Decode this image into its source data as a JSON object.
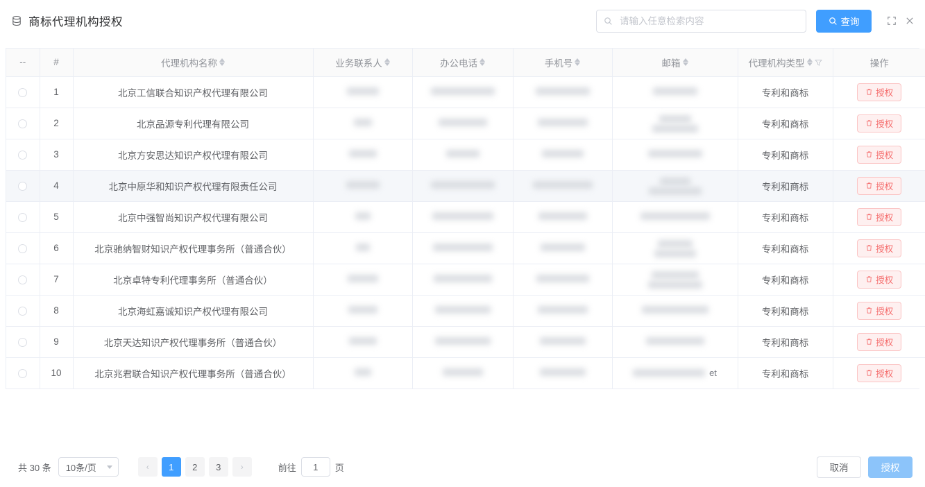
{
  "header": {
    "title": "商标代理机构授权",
    "icon": "database-icon",
    "search": {
      "placeholder": "请输入任意检索内容",
      "value": "",
      "icon": "search-icon"
    },
    "query_button": "查询",
    "fullscreen_icon": "fullscreen-icon",
    "close_icon": "close-icon"
  },
  "table": {
    "columns": [
      {
        "label": "--",
        "sortable": false,
        "filterable": false
      },
      {
        "label": "#",
        "sortable": false,
        "filterable": false
      },
      {
        "label": "代理机构名称",
        "sortable": true,
        "filterable": false
      },
      {
        "label": "业务联系人",
        "sortable": true,
        "filterable": false
      },
      {
        "label": "办公电话",
        "sortable": true,
        "filterable": false
      },
      {
        "label": "手机号",
        "sortable": true,
        "filterable": false
      },
      {
        "label": "邮箱",
        "sortable": true,
        "filterable": false
      },
      {
        "label": "代理机构类型",
        "sortable": true,
        "filterable": true
      },
      {
        "label": "操作",
        "sortable": false,
        "filterable": false
      }
    ],
    "action_label": "授权",
    "action_icon": "trash-icon",
    "rows": [
      {
        "index": "1",
        "name": "北京工信联合知识产权代理有限公司",
        "contact_redacted": true,
        "office_phone_redacted": true,
        "mobile_redacted": true,
        "email_redacted": true,
        "email_tail": "",
        "type": "专利和商标",
        "hovered": false
      },
      {
        "index": "2",
        "name": "北京品源专利代理有限公司",
        "contact_redacted": true,
        "office_phone_redacted": true,
        "mobile_redacted": true,
        "email_redacted": true,
        "email_tail": "",
        "type": "专利和商标",
        "hovered": false
      },
      {
        "index": "3",
        "name": "北京方安思达知识产权代理有限公司",
        "contact_redacted": true,
        "office_phone_redacted": true,
        "mobile_redacted": true,
        "email_redacted": true,
        "email_tail": "",
        "type": "专利和商标",
        "hovered": false
      },
      {
        "index": "4",
        "name": "北京中原华和知识产权代理有限责任公司",
        "contact_redacted": true,
        "office_phone_redacted": true,
        "mobile_redacted": true,
        "email_redacted": true,
        "email_tail": "",
        "type": "专利和商标",
        "hovered": true
      },
      {
        "index": "5",
        "name": "北京中强智尚知识产权代理有限公司",
        "contact_redacted": true,
        "office_phone_redacted": true,
        "mobile_redacted": true,
        "email_redacted": true,
        "email_tail": "",
        "type": "专利和商标",
        "hovered": false
      },
      {
        "index": "6",
        "name": "北京驰纳智财知识产权代理事务所（普通合伙）",
        "contact_redacted": true,
        "office_phone_redacted": true,
        "mobile_redacted": true,
        "email_redacted": true,
        "email_tail": "",
        "type": "专利和商标",
        "hovered": false
      },
      {
        "index": "7",
        "name": "北京卓特专利代理事务所（普通合伙）",
        "contact_redacted": true,
        "office_phone_redacted": true,
        "mobile_redacted": true,
        "email_redacted": true,
        "email_tail": "",
        "type": "专利和商标",
        "hovered": false
      },
      {
        "index": "8",
        "name": "北京海虹嘉诚知识产权代理有限公司",
        "contact_redacted": true,
        "office_phone_redacted": true,
        "mobile_redacted": true,
        "email_redacted": true,
        "email_tail": "",
        "type": "专利和商标",
        "hovered": false
      },
      {
        "index": "9",
        "name": "北京天达知识产权代理事务所（普通合伙）",
        "contact_redacted": true,
        "office_phone_redacted": true,
        "mobile_redacted": true,
        "email_redacted": true,
        "email_tail": "",
        "type": "专利和商标",
        "hovered": false
      },
      {
        "index": "10",
        "name": "北京兆君联合知识产权代理事务所（普通合伙）",
        "contact_redacted": true,
        "office_phone_redacted": true,
        "mobile_redacted": true,
        "email_redacted": true,
        "email_tail": "et",
        "type": "专利和商标",
        "hovered": false
      }
    ]
  },
  "footer": {
    "total_text": "共 30 条",
    "page_size": "10条/页",
    "prev_label": "‹",
    "next_label": "›",
    "pages": [
      "1",
      "2",
      "3"
    ],
    "active_page": "1",
    "jump_prefix": "前往",
    "jump_value": "1",
    "jump_suffix": "页",
    "cancel_label": "取消",
    "confirm_label": "授权"
  },
  "colors": {
    "primary": "#409eff",
    "danger": "#f56c6c",
    "danger_bg": "#fef0f0",
    "border": "#ebeef5",
    "hover_row": "#f5f7fa",
    "confirm_disabled": "#8cc4fa"
  }
}
